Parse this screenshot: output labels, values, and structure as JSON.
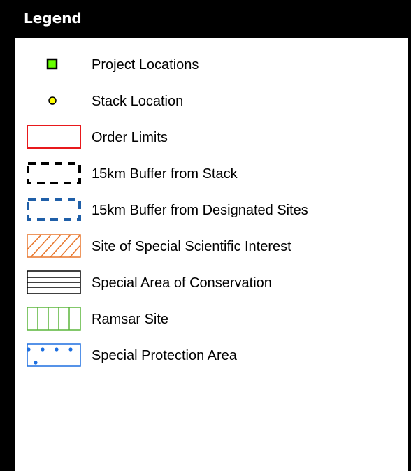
{
  "legend": {
    "title": "Legend",
    "items": [
      {
        "label": "Project Locations",
        "symbol": "green-square-icon",
        "color": "#66ff00"
      },
      {
        "label": "Stack Location",
        "symbol": "yellow-circle-icon",
        "color": "#ffff00"
      },
      {
        "label": "Order Limits",
        "symbol": "red-outline-box-icon",
        "color": "#e8191c"
      },
      {
        "label": "15km Buffer from Stack",
        "symbol": "black-dashed-box-icon",
        "color": "#000000"
      },
      {
        "label": "15km Buffer from Designated Sites",
        "symbol": "blue-dashed-box-icon",
        "color": "#1f5fa8"
      },
      {
        "label": "Site of Special Scientific Interest",
        "symbol": "orange-hatched-box-icon",
        "color": "#e8752a"
      },
      {
        "label": "Special Area of Conservation",
        "symbol": "black-horizontal-lines-box-icon",
        "color": "#000000"
      },
      {
        "label": "Ramsar Site",
        "symbol": "green-vertical-lines-box-icon",
        "color": "#5ab53a"
      },
      {
        "label": "Special Protection Area",
        "symbol": "blue-dotted-box-icon",
        "color": "#1d6fe0"
      }
    ]
  }
}
